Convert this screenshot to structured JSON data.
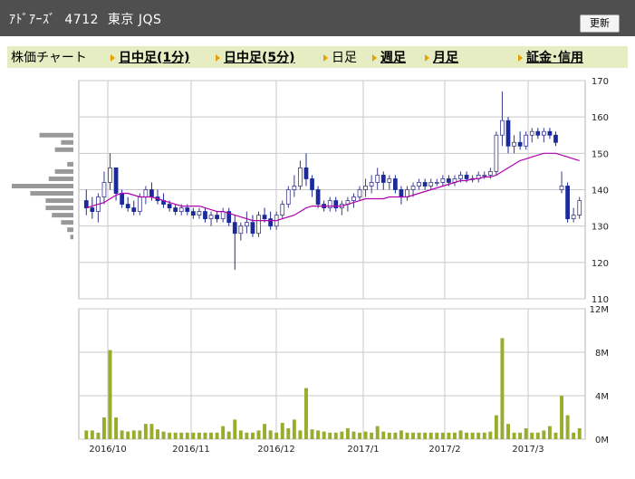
{
  "header": {
    "title": "ｱﾄﾞｱｰｽﾞ  4712  東京 JQS",
    "refresh_label": "更新"
  },
  "tabs": [
    {
      "label": "株価チャート",
      "link": false,
      "arrow": false
    },
    {
      "label": "日中足(1分)",
      "link": true,
      "arrow": true
    },
    {
      "label": "日中足(5分)",
      "link": true,
      "arrow": true
    },
    {
      "label": "日足",
      "link": false,
      "arrow": true
    },
    {
      "label": "週足",
      "link": true,
      "arrow": true
    },
    {
      "label": "月足",
      "link": true,
      "arrow": true
    },
    {
      "label": "証金･信用",
      "link": true,
      "arrow": true
    }
  ],
  "colors": {
    "up": "#3a3a8e",
    "down": "#1a2a9a",
    "ma": "#b000b0",
    "volume": "#9aac2e",
    "profile": "#999999",
    "grid": "#c8c8c8",
    "frame": "#b0b0b0"
  },
  "chart_data": [
    {
      "type": "candlestick",
      "title": "",
      "ylim": [
        110,
        170
      ],
      "y_ticks": [
        "110",
        "120",
        "130",
        "140",
        "150",
        "160",
        "170"
      ],
      "x_ticks": [
        "2016/10",
        "2016/11",
        "2016/12",
        "2017/1",
        "2017/2",
        "2017/3"
      ],
      "ohlc": [
        [
          137,
          140,
          133,
          135
        ],
        [
          135,
          138,
          132,
          134
        ],
        [
          134,
          139,
          131,
          138
        ],
        [
          138,
          145,
          136,
          142
        ],
        [
          142,
          150,
          140,
          146
        ],
        [
          146,
          146,
          137,
          139
        ],
        [
          139,
          140,
          135,
          136
        ],
        [
          136,
          138,
          134,
          135
        ],
        [
          135,
          137,
          133,
          134
        ],
        [
          134,
          139,
          133,
          138
        ],
        [
          138,
          141,
          136,
          140
        ],
        [
          140,
          142,
          137,
          138
        ],
        [
          138,
          140,
          136,
          137
        ],
        [
          137,
          139,
          135,
          136
        ],
        [
          136,
          137,
          134,
          135
        ],
        [
          135,
          136,
          133,
          134
        ],
        [
          134,
          136,
          133,
          135
        ],
        [
          135,
          136,
          133,
          134
        ],
        [
          134,
          135,
          132,
          133
        ],
        [
          133,
          135,
          132,
          134
        ],
        [
          134,
          135,
          131,
          132
        ],
        [
          132,
          134,
          130,
          133
        ],
        [
          133,
          134,
          131,
          132
        ],
        [
          132,
          135,
          131,
          134
        ],
        [
          134,
          135,
          130,
          131
        ],
        [
          131,
          133,
          118,
          128
        ],
        [
          128,
          131,
          126,
          130
        ],
        [
          130,
          134,
          128,
          131
        ],
        [
          131,
          133,
          127,
          128
        ],
        [
          128,
          134,
          127,
          133
        ],
        [
          133,
          135,
          131,
          132
        ],
        [
          132,
          134,
          129,
          130
        ],
        [
          130,
          134,
          129,
          133
        ],
        [
          133,
          137,
          132,
          136
        ],
        [
          136,
          141,
          135,
          140
        ],
        [
          140,
          144,
          138,
          141
        ],
        [
          141,
          148,
          140,
          146
        ],
        [
          146,
          150,
          141,
          143
        ],
        [
          143,
          144,
          138,
          140
        ],
        [
          140,
          141,
          135,
          136
        ],
        [
          136,
          137,
          134,
          135
        ],
        [
          135,
          138,
          134,
          137
        ],
        [
          137,
          138,
          134,
          135
        ],
        [
          135,
          137,
          133,
          136
        ],
        [
          136,
          138,
          134,
          137
        ],
        [
          137,
          139,
          135,
          138
        ],
        [
          138,
          141,
          137,
          140
        ],
        [
          140,
          143,
          138,
          141
        ],
        [
          141,
          144,
          139,
          142
        ],
        [
          142,
          146,
          140,
          144
        ],
        [
          144,
          145,
          140,
          142
        ],
        [
          142,
          144,
          140,
          143
        ],
        [
          143,
          144,
          139,
          140
        ],
        [
          140,
          141,
          136,
          138
        ],
        [
          138,
          141,
          137,
          140
        ],
        [
          140,
          142,
          138,
          141
        ],
        [
          141,
          143,
          140,
          142
        ],
        [
          142,
          143,
          140,
          141
        ],
        [
          141,
          143,
          140,
          142
        ],
        [
          142,
          143,
          141,
          142
        ],
        [
          142,
          144,
          141,
          143
        ],
        [
          143,
          144,
          141,
          142
        ],
        [
          142,
          144,
          141,
          143
        ],
        [
          143,
          145,
          142,
          144
        ],
        [
          144,
          145,
          142,
          143
        ],
        [
          143,
          144,
          142,
          143
        ],
        [
          143,
          145,
          142,
          144
        ],
        [
          144,
          145,
          143,
          144
        ],
        [
          144,
          146,
          143,
          145
        ],
        [
          145,
          156,
          144,
          155
        ],
        [
          155,
          167,
          152,
          159
        ],
        [
          159,
          160,
          150,
          152
        ],
        [
          152,
          155,
          150,
          153
        ],
        [
          153,
          156,
          151,
          152
        ],
        [
          152,
          156,
          151,
          155
        ],
        [
          155,
          157,
          153,
          156
        ],
        [
          156,
          157,
          154,
          155
        ],
        [
          155,
          157,
          153,
          156
        ],
        [
          156,
          157,
          154,
          155
        ],
        [
          155,
          156,
          152,
          153
        ],
        [
          140,
          145,
          139,
          141
        ],
        [
          141,
          142,
          131,
          132
        ],
        [
          132,
          135,
          131,
          133
        ],
        [
          133,
          138,
          132,
          137
        ]
      ],
      "ma": [
        135,
        135.5,
        136,
        136.5,
        137.5,
        138.5,
        139,
        139,
        138.5,
        138,
        138,
        138,
        137.5,
        137,
        136.5,
        136,
        135.5,
        135.5,
        135.5,
        135.5,
        135,
        134.5,
        134,
        134,
        133.5,
        133,
        132.5,
        132,
        131.5,
        131.5,
        131.5,
        131.5,
        131.5,
        132,
        132.5,
        133,
        134,
        135,
        135.5,
        135.5,
        135.5,
        135.5,
        135.5,
        135.5,
        136,
        136.5,
        137,
        137.5,
        137.5,
        137.5,
        137.5,
        138,
        138,
        138,
        138,
        138.5,
        139,
        139.5,
        140,
        140.5,
        141,
        141.5,
        142,
        142.5,
        142.5,
        143,
        143,
        143.5,
        143.5,
        144,
        145,
        146,
        147,
        148,
        148.5,
        149,
        149.5,
        150,
        150,
        150,
        149.5,
        149,
        148.5,
        148
      ],
      "volume_ylim": [
        0,
        12
      ],
      "volume_ticks": [
        "0M",
        "4M",
        "8M",
        "12M"
      ],
      "volume": [
        0.8,
        0.8,
        0.6,
        2.0,
        8.2,
        2.0,
        0.8,
        0.7,
        0.8,
        0.8,
        1.4,
        1.4,
        0.9,
        0.7,
        0.6,
        0.6,
        0.6,
        0.6,
        0.6,
        0.6,
        0.6,
        0.6,
        0.6,
        1.2,
        0.7,
        1.8,
        0.8,
        0.6,
        0.6,
        0.8,
        1.4,
        0.8,
        0.6,
        1.5,
        1.0,
        1.8,
        0.8,
        4.7,
        0.9,
        0.8,
        0.7,
        0.6,
        0.6,
        0.7,
        1.0,
        0.7,
        0.6,
        0.7,
        0.6,
        1.2,
        0.7,
        0.6,
        0.6,
        0.8,
        0.6,
        0.6,
        0.6,
        0.6,
        0.6,
        0.6,
        0.6,
        0.6,
        0.6,
        0.8,
        0.6,
        0.6,
        0.6,
        0.6,
        0.7,
        2.2,
        9.3,
        1.4,
        0.6,
        0.6,
        1.0,
        0.6,
        0.6,
        0.8,
        1.2,
        0.6,
        4.0,
        2.2,
        0.6,
        1.0
      ],
      "price_profile": [
        {
          "price": 155,
          "weight": 0.55
        },
        {
          "price": 153,
          "weight": 0.2
        },
        {
          "price": 151,
          "weight": 0.3
        },
        {
          "price": 147,
          "weight": 0.1
        },
        {
          "price": 145,
          "weight": 0.3
        },
        {
          "price": 143,
          "weight": 0.4
        },
        {
          "price": 141,
          "weight": 1.0
        },
        {
          "price": 139,
          "weight": 0.7
        },
        {
          "price": 137,
          "weight": 0.45
        },
        {
          "price": 135,
          "weight": 0.45
        },
        {
          "price": 133,
          "weight": 0.35
        },
        {
          "price": 131,
          "weight": 0.2
        },
        {
          "price": 129,
          "weight": 0.1
        },
        {
          "price": 127,
          "weight": 0.05
        }
      ]
    }
  ]
}
